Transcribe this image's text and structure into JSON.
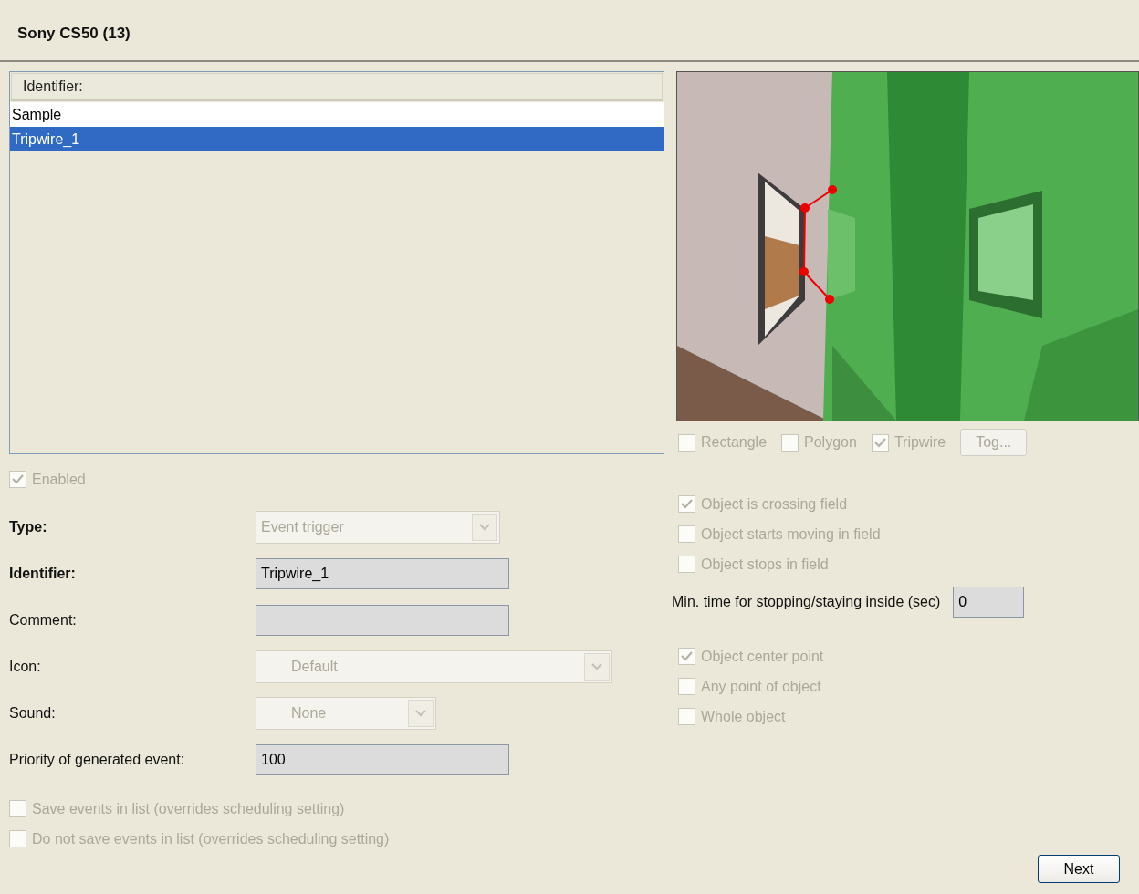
{
  "header": {
    "title": "Sony CS50 (13)"
  },
  "list": {
    "column": "Identifier:",
    "rows": [
      {
        "label": "Sample",
        "selected": false
      },
      {
        "label": "Tripwire_1",
        "selected": true
      }
    ]
  },
  "enabled": {
    "label": "Enabled",
    "checked": true
  },
  "fields": [
    {
      "kind": "select",
      "label": "Type:",
      "bold": true,
      "value": "Event trigger"
    },
    {
      "kind": "input",
      "label": "Identifier:",
      "bold": true,
      "value": "Tripwire_1"
    },
    {
      "kind": "input",
      "label": "Comment:",
      "bold": false
    },
    {
      "kind": "select",
      "label": "Icon:",
      "bold": false,
      "value": "Default"
    },
    {
      "kind": "select",
      "label": "Sound:",
      "bold": false,
      "value": "None"
    },
    {
      "kind": "input",
      "label": "Priority of generated event:",
      "bold": false,
      "value": "100"
    }
  ],
  "save_options": [
    {
      "label": "Save events in list (overrides scheduling setting)",
      "checked": false
    },
    {
      "label": "Do not save events in list (overrides scheduling setting)",
      "checked": false
    }
  ],
  "shapes": [
    {
      "label": "Rectangle",
      "checked": false
    },
    {
      "label": "Polygon",
      "checked": false
    },
    {
      "label": "Tripwire",
      "checked": true
    }
  ],
  "toggle_button": "Tog...",
  "conditions": [
    {
      "label": "Object is crossing field",
      "checked": true
    },
    {
      "label": "Object starts moving in field",
      "checked": false
    },
    {
      "label": "Object stops in field",
      "checked": false
    }
  ],
  "min_time": {
    "label": "Min. time for stopping/staying inside (sec)",
    "value": "0"
  },
  "points": [
    {
      "label": "Object center point",
      "checked": true
    },
    {
      "label": "Any point of object",
      "checked": false
    },
    {
      "label": "Whole object",
      "checked": false
    }
  ],
  "next_button": "Next"
}
